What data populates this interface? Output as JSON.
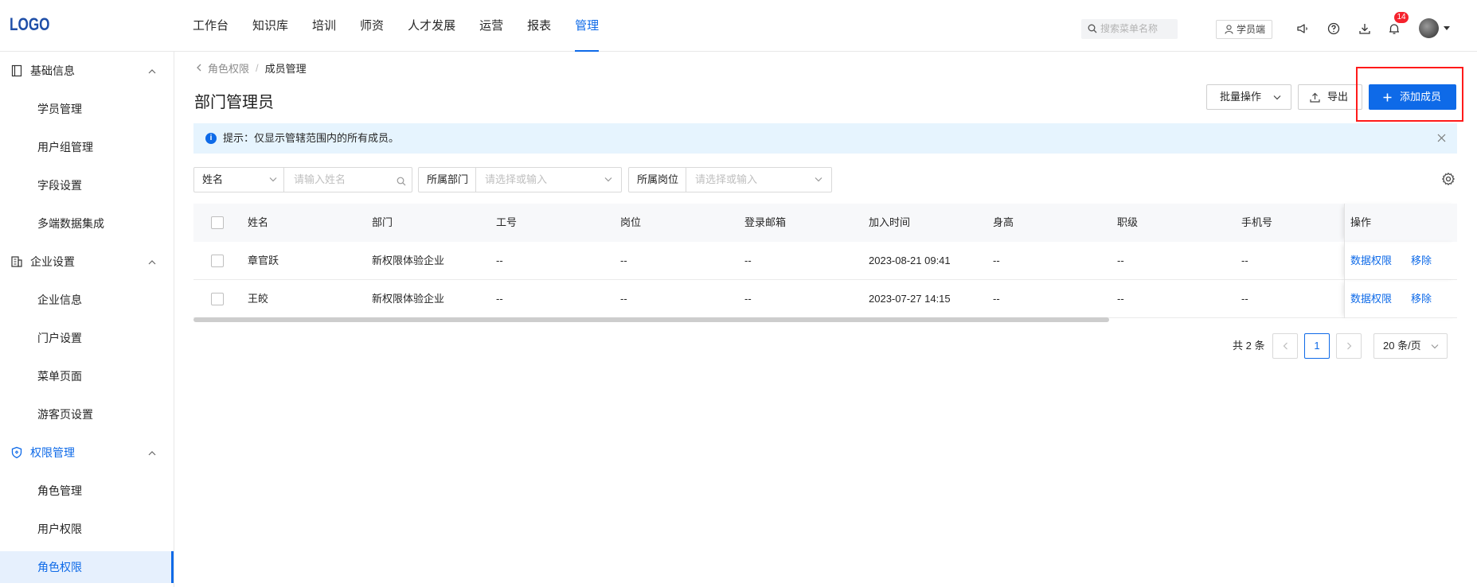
{
  "brand": {
    "logo": "LOGO"
  },
  "nav": {
    "items": [
      {
        "label": "工作台"
      },
      {
        "label": "知识库"
      },
      {
        "label": "培训"
      },
      {
        "label": "师资"
      },
      {
        "label": "人才发展"
      },
      {
        "label": "运营"
      },
      {
        "label": "报表"
      },
      {
        "label": "管理"
      }
    ],
    "active_index": 7
  },
  "header": {
    "search_placeholder": "搜索菜单名称",
    "student_button": "学员端",
    "notification_count": "14"
  },
  "sidebar": {
    "groups": [
      {
        "label": "基础信息",
        "items": [
          "学员管理",
          "用户组管理",
          "字段设置",
          "多端数据集成"
        ]
      },
      {
        "label": "企业设置",
        "items": [
          "企业信息",
          "门户设置",
          "菜单页面",
          "游客页设置"
        ]
      },
      {
        "label": "权限管理",
        "items": [
          "角色管理",
          "用户权限",
          "角色权限"
        ]
      }
    ],
    "active_item": "角色权限"
  },
  "breadcrumb": {
    "parent": "角色权限",
    "separator": "/",
    "current": "成员管理"
  },
  "page": {
    "title": "部门管理员",
    "batch_button": "批量操作",
    "export_button": "导出",
    "add_button": "添加成员",
    "alert": "提示：仅显示管辖范围内的所有成员。"
  },
  "filters": {
    "name_select": "姓名",
    "name_placeholder": "请输入姓名",
    "dept_label": "所属部门",
    "dept_placeholder": "请选择或输入",
    "post_label": "所属岗位",
    "post_placeholder": "请选择或输入"
  },
  "table": {
    "columns": [
      "姓名",
      "部门",
      "工号",
      "岗位",
      "登录邮箱",
      "加入时间",
      "身高",
      "职级",
      "手机号",
      "操作"
    ],
    "rows": [
      {
        "name": "章官跃",
        "dept": "新权限体验企业",
        "emp_no": "--",
        "post": "--",
        "email": "--",
        "joined": "2023-08-21 09:41",
        "height": "--",
        "rank": "--",
        "phone": "--"
      },
      {
        "name": "王皎",
        "dept": "新权限体验企业",
        "emp_no": "--",
        "post": "--",
        "email": "--",
        "joined": "2023-07-27 14:15",
        "height": "--",
        "rank": "--",
        "phone": "--"
      }
    ],
    "actions": {
      "data_permission": "数据权限",
      "remove": "移除"
    }
  },
  "pagination": {
    "total": "共 2 条",
    "current_page": "1",
    "page_size": "20 条/页"
  },
  "colors": {
    "primary": "#0e6ae8",
    "highlight": "#ff1a1a",
    "badge": "#f5222d"
  }
}
